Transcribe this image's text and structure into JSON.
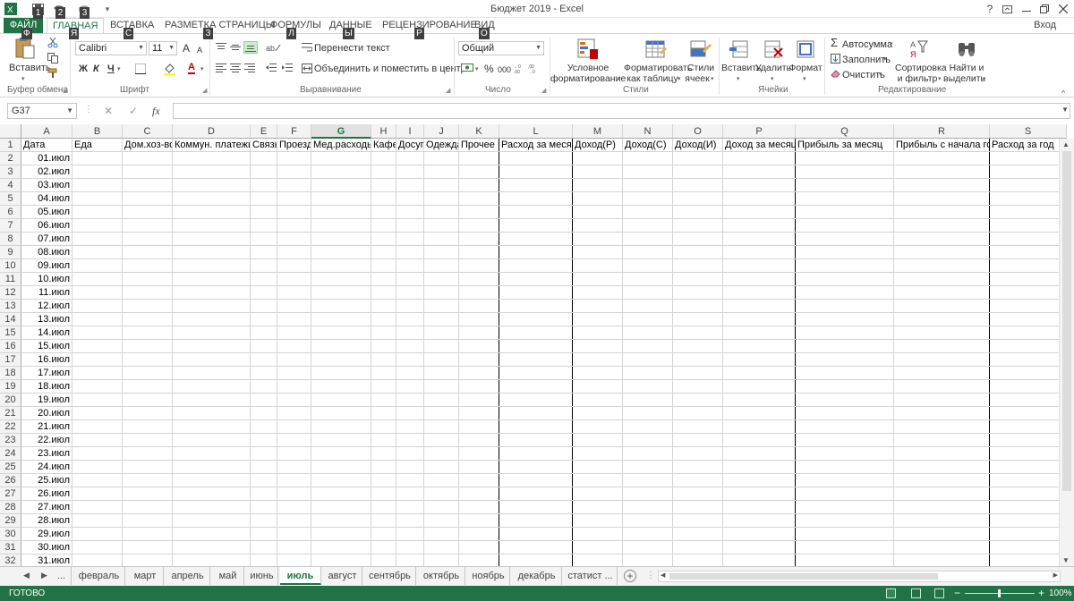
{
  "window": {
    "title": "Бюджет 2019 - Excel",
    "help_label": "?",
    "login_label": "Вход"
  },
  "qat": {
    "keytips": [
      "1",
      "2",
      "3"
    ]
  },
  "ribbon_tabs": [
    {
      "label": "ФАЙЛ",
      "keytip": "Ф"
    },
    {
      "label": "ГЛАВНАЯ",
      "keytip": "Я"
    },
    {
      "label": "ВСТАВКА",
      "keytip": "С"
    },
    {
      "label": "РАЗМЕТКА СТРАНИЦЫ",
      "keytip": "З"
    },
    {
      "label": "ФОРМУЛЫ",
      "keytip": "Л"
    },
    {
      "label": "ДАННЫЕ",
      "keytip": "Ы"
    },
    {
      "label": "РЕЦЕНЗИРОВАНИЕ",
      "keytip": "Р"
    },
    {
      "label": "ВИД",
      "keytip": "О"
    }
  ],
  "ribbon": {
    "paste_label": "Вставить",
    "clipboard_label": "Буфер обмена",
    "font_name": "Calibri",
    "font_size": "11",
    "font_label": "Шрифт",
    "bold": "Ж",
    "italic": "К",
    "underline": "Ч",
    "grow": "A",
    "shrink": "A",
    "font_color": "A",
    "wrap_text": "Перенести текст",
    "merge_center": "Объединить и поместить в центре",
    "alignment_label": "Выравнивание",
    "number_format": "Общий",
    "percent": "%",
    "thousands": "000",
    "number_label": "Число",
    "cond_format_1": "Условное",
    "cond_format_2": "форматирование",
    "format_table_1": "Форматировать",
    "format_table_2": "как таблицу",
    "cell_styles_1": "Стили",
    "cell_styles_2": "ячеек",
    "styles_label": "Стили",
    "insert_label": "Вставить",
    "delete_label": "Удалить",
    "format_label": "Формат",
    "cells_label": "Ячейки",
    "autosum": "Автосумма",
    "fill": "Заполнить",
    "clear": "Очистить",
    "sort_1": "Сортировка",
    "sort_2": "и фильтр",
    "find_1": "Найти и",
    "find_2": "выделить",
    "editing_label": "Редактирование"
  },
  "formula_bar": {
    "name_box": "G37",
    "value": ""
  },
  "columns": [
    "A",
    "B",
    "C",
    "D",
    "E",
    "F",
    "G",
    "H",
    "I",
    "J",
    "K",
    "L",
    "M",
    "N",
    "O",
    "P",
    "Q",
    "R",
    "S"
  ],
  "selected_column": "G",
  "header_row": [
    "Дата",
    "Еда",
    "Дом.хоз-во",
    "Коммун. платежи",
    "Связь",
    "Проезд",
    "Мед.расходы",
    "Кафе",
    "Досуг",
    "Одежда",
    "Прочее",
    "Расход за месяц",
    "Доход(Р)",
    "Доход(С)",
    "Доход(И)",
    "Доход за месяц",
    "Прибыль за месяц",
    "Прибыль с начала года",
    "Расход за год"
  ],
  "row_numbers": [
    "1",
    "2",
    "3",
    "4",
    "5",
    "6",
    "7",
    "8",
    "9",
    "10",
    "11",
    "12",
    "13",
    "14",
    "15",
    "16",
    "17",
    "18",
    "19",
    "20",
    "21",
    "22",
    "23",
    "24",
    "25",
    "26",
    "27",
    "28",
    "29",
    "30",
    "31",
    "32"
  ],
  "dates": [
    "01.июл",
    "02.июл",
    "03.июл",
    "04.июл",
    "05.июл",
    "06.июл",
    "07.июл",
    "08.июл",
    "09.июл",
    "10.июл",
    "11.июл",
    "12.июл",
    "13.июл",
    "14.июл",
    "15.июл",
    "16.июл",
    "17.июл",
    "18.июл",
    "19.июл",
    "20.июл",
    "21.июл",
    "22.июл",
    "23.июл",
    "24.июл",
    "25.июл",
    "26.июл",
    "27.июл",
    "28.июл",
    "29.июл",
    "30.июл",
    "31.июл"
  ],
  "sheets": [
    "...",
    "февраль",
    "март",
    "апрель",
    "май",
    "июнь",
    "июль",
    "август",
    "сентябрь",
    "октябрь",
    "ноябрь",
    "декабрь",
    "статист ..."
  ],
  "active_sheet": "июль",
  "status": {
    "ready": "ГОТОВО",
    "zoom": "100%"
  },
  "colors": {
    "accent": "#217346",
    "header_bg": "#f3f3f3",
    "grid": "#d4d4d4"
  }
}
